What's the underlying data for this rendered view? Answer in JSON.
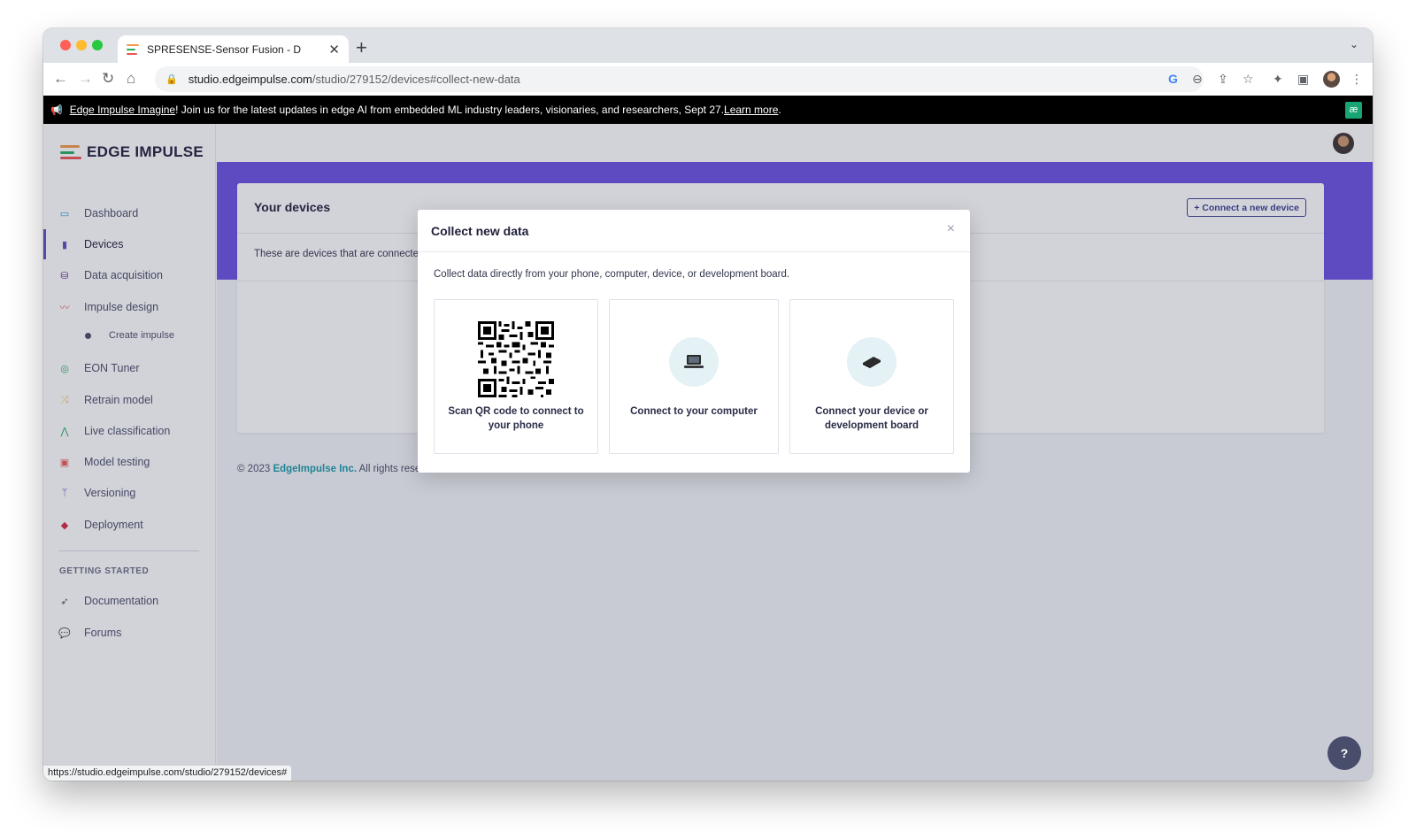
{
  "browser": {
    "tab_title": "SPRESENSE-Sensor Fusion - D",
    "new_tab_icon": "plus-icon",
    "url_host": "studio.edgeimpulse.com",
    "url_path": "/studio/279152/devices#collect-new-data",
    "status_url": "https://studio.edgeimpulse.com/studio/279152/devices#"
  },
  "announcement": {
    "link": "Edge Impulse Imagine",
    "text": "! Join us for the latest updates in edge AI from embedded ML industry leaders, visionaries, and researchers, Sept 27. ",
    "learn_more": "Learn more",
    "tail": "."
  },
  "sidebar": {
    "logo": "EDGE IMPULSE",
    "items": [
      {
        "label": "Dashboard",
        "icon": "monitor-icon"
      },
      {
        "label": "Devices",
        "icon": "device-icon"
      },
      {
        "label": "Data acquisition",
        "icon": "database-icon"
      },
      {
        "label": "Impulse design",
        "icon": "pulse-icon"
      },
      {
        "label": "EON Tuner",
        "icon": "compass-icon"
      },
      {
        "label": "Retrain model",
        "icon": "shuffle-icon"
      },
      {
        "label": "Live classification",
        "icon": "graph-icon"
      },
      {
        "label": "Model testing",
        "icon": "clipboard-icon"
      },
      {
        "label": "Versioning",
        "icon": "branch-icon"
      },
      {
        "label": "Deployment",
        "icon": "box-icon"
      }
    ],
    "sub_item": "Create impulse",
    "section_title": "GETTING STARTED",
    "getting_started": [
      {
        "label": "Documentation",
        "icon": "rocket-icon"
      },
      {
        "label": "Forums",
        "icon": "chat-icon"
      }
    ]
  },
  "main": {
    "card_title": "Your devices",
    "connect_button": "+ Connect a new device",
    "card_desc": "These are devices that are connecte",
    "footer_prefix": "© 2023  ",
    "footer_company": "EdgeImpulse Inc.",
    "footer_suffix": " All rights reserved"
  },
  "modal": {
    "title": "Collect new data",
    "close": "×",
    "description": "Collect data directly from your phone, computer, device, or development board.",
    "options": [
      {
        "label": "Scan QR code to connect to your phone",
        "icon": "qr-code-icon"
      },
      {
        "label": "Connect to your computer",
        "icon": "laptop-icon"
      },
      {
        "label": "Connect your device or development board",
        "icon": "board-icon"
      }
    ]
  },
  "colors": {
    "accent": "#6b51e0",
    "brand_teal": "#1b9aaa",
    "announcement_bg": "#000000"
  }
}
